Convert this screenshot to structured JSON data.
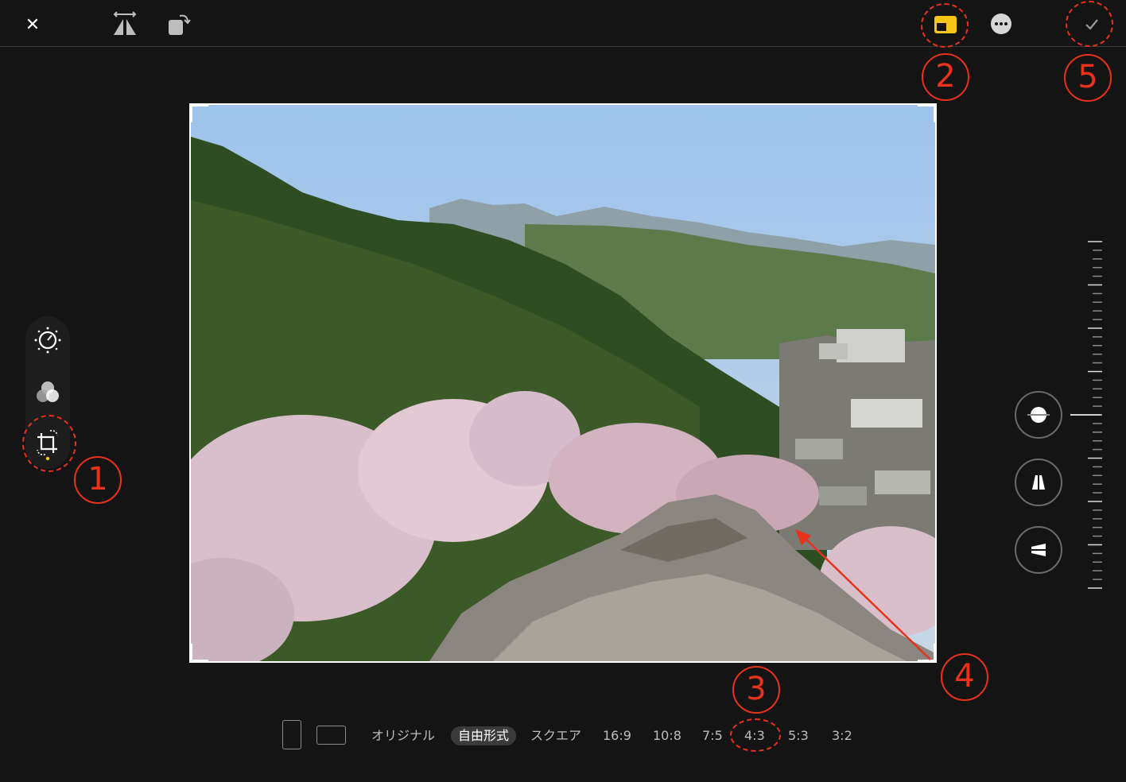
{
  "toolbar": {
    "close_icon": "close-icon",
    "flip_icon": "flip-horizontal-icon",
    "rotate_icon": "rotate-icon",
    "aspect_icon": "aspect-ratio-icon",
    "more_icon": "more-icon",
    "done_icon": "checkmark-icon",
    "close_glyph": "✕",
    "accent_color": "#f5c518"
  },
  "tools": [
    {
      "name": "adjust",
      "icon": "adjust-dial-icon"
    },
    {
      "name": "filters",
      "icon": "filters-icon"
    },
    {
      "name": "crop",
      "icon": "crop-rotate-icon",
      "active": true
    }
  ],
  "photo": {
    "subject": "mountain village with cherry blossoms"
  },
  "straighten": {
    "buttons": [
      "straighten-icon",
      "vertical-perspective-icon",
      "horizontal-perspective-icon"
    ]
  },
  "ratios": {
    "orientation": [
      "portrait-icon",
      "landscape-icon"
    ],
    "items": [
      "オリジナル",
      "自由形式",
      "スクエア",
      "16:9",
      "10:8",
      "7:5",
      "4:3",
      "5:3",
      "3:2"
    ],
    "selected": "自由形式"
  },
  "annotations": {
    "labels": [
      "1",
      "2",
      "3",
      "4",
      "5"
    ],
    "color": "#e8321c"
  }
}
